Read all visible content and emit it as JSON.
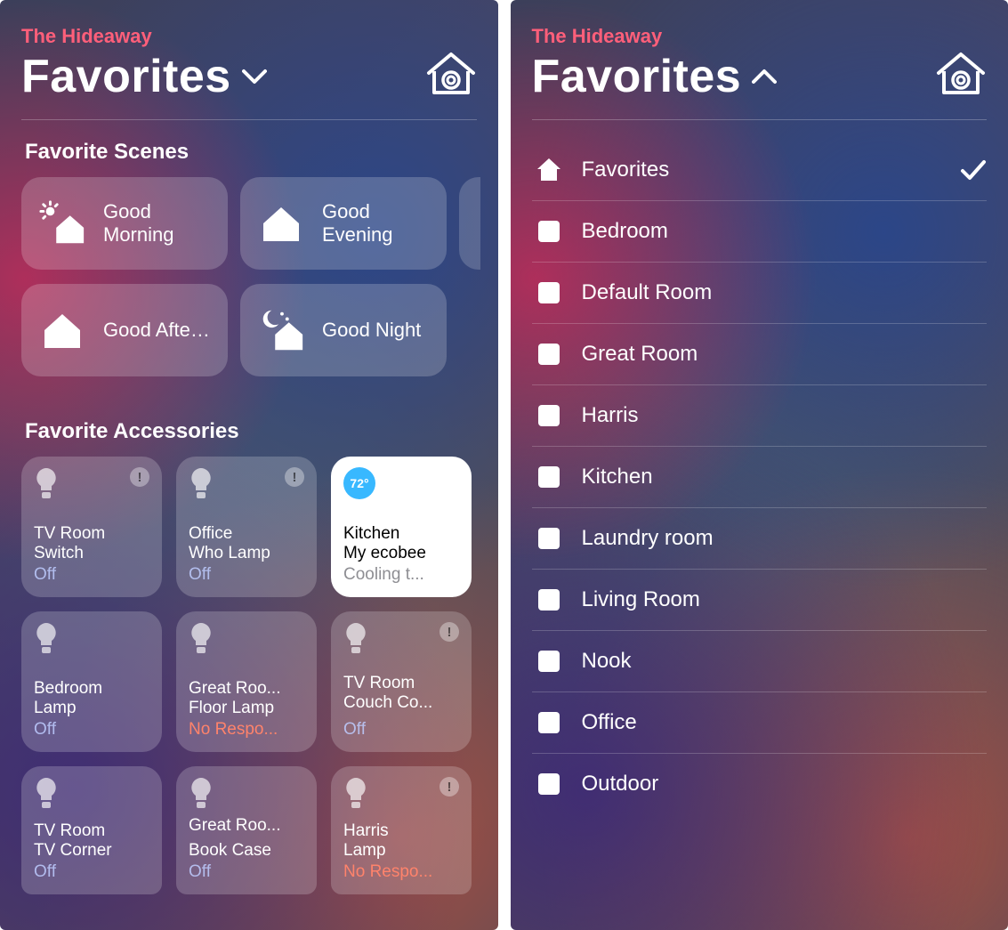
{
  "left": {
    "homeName": "The Hideaway",
    "title": "Favorites",
    "sections": {
      "scenes": "Favorite Scenes",
      "accessories": "Favorite Accessories"
    },
    "scenes": [
      {
        "label": "Good Morning",
        "icon": "sunrise-house"
      },
      {
        "label": "Good Evening",
        "icon": "house"
      },
      {
        "label": "Good Aftern...",
        "icon": "house"
      },
      {
        "label": "Good Night",
        "icon": "moon-house"
      }
    ],
    "accessories": [
      {
        "line1": "TV Room",
        "line2": "Switch",
        "status": "Off",
        "statusKind": "off",
        "alert": true,
        "kind": "bulb"
      },
      {
        "line1": "Office",
        "line2": "Who Lamp",
        "status": "Off",
        "statusKind": "off",
        "alert": true,
        "kind": "bulb"
      },
      {
        "line1": "Kitchen",
        "line2": "My ecobee",
        "status": "Cooling t...",
        "statusKind": "cool",
        "alert": false,
        "kind": "thermo",
        "temp": "72°",
        "active": true
      },
      {
        "line1": "Bedroom",
        "line2": "Lamp",
        "status": "Off",
        "statusKind": "off",
        "alert": false,
        "kind": "bulb"
      },
      {
        "line1": "Great Roo...",
        "line2": "Floor Lamp",
        "status": "No Respo...",
        "statusKind": "nr",
        "alert": false,
        "kind": "bulb"
      },
      {
        "line1": "TV Room",
        "line2": "Couch Co...",
        "status": "Off",
        "statusKind": "off",
        "alert": true,
        "kind": "bulb"
      },
      {
        "line1": "TV Room",
        "line2": "TV Corner",
        "status": "Off",
        "statusKind": "off",
        "alert": false,
        "kind": "bulb"
      },
      {
        "line1": "Great Roo...",
        "line2": "Book Case",
        "status": "Off",
        "statusKind": "off",
        "alert": false,
        "kind": "bulb"
      },
      {
        "line1": "Harris",
        "line2": "Lamp",
        "status": "No Respo...",
        "statusKind": "nr",
        "alert": true,
        "kind": "bulb"
      }
    ]
  },
  "right": {
    "homeName": "The Hideaway",
    "title": "Favorites",
    "rooms": [
      {
        "label": "Favorites",
        "icon": "fav",
        "selected": true
      },
      {
        "label": "Bedroom",
        "icon": "room",
        "selected": false
      },
      {
        "label": "Default Room",
        "icon": "room",
        "selected": false
      },
      {
        "label": "Great Room",
        "icon": "room",
        "selected": false
      },
      {
        "label": "Harris",
        "icon": "room",
        "selected": false
      },
      {
        "label": "Kitchen",
        "icon": "room",
        "selected": false
      },
      {
        "label": "Laundry room",
        "icon": "room",
        "selected": false
      },
      {
        "label": "Living Room",
        "icon": "room",
        "selected": false
      },
      {
        "label": "Nook",
        "icon": "room",
        "selected": false
      },
      {
        "label": "Office",
        "icon": "room",
        "selected": false
      },
      {
        "label": "Outdoor",
        "icon": "room",
        "selected": false
      }
    ]
  }
}
